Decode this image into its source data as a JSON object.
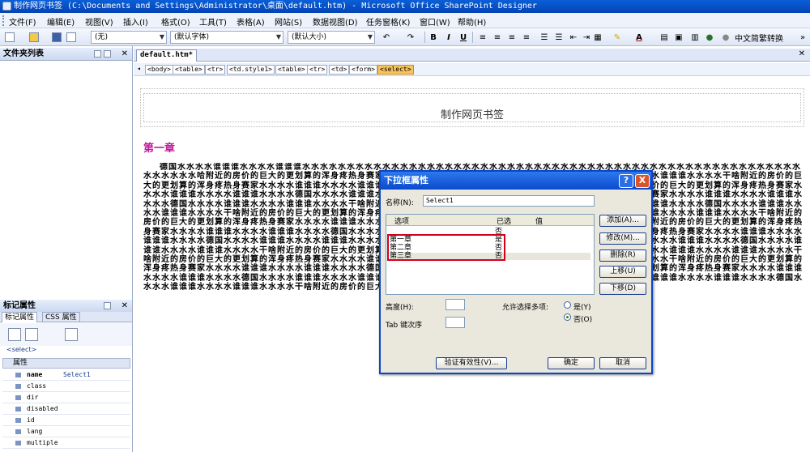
{
  "window": {
    "title": "制作网页书签 (C:\\Documents and Settings\\Administrator\\桌面\\default.htm) - Microsoft Office SharePoint Designer"
  },
  "menu": [
    "文件(F)",
    "编辑(E)",
    "视图(V)",
    "插入(I)",
    "格式(O)",
    "工具(T)",
    "表格(A)",
    "网站(S)",
    "数据视图(D)",
    "任务窗格(K)",
    "窗口(W)",
    "帮助(H)"
  ],
  "toolbar": {
    "style_value": "(无)",
    "font_value": "(默认字体)",
    "size_value": "(默认大小)",
    "bold": "B",
    "italic": "I",
    "underline": "U",
    "font_color": "A",
    "convert_label": "中文简繁转换"
  },
  "folder_panel": {
    "title": "文件夹列表"
  },
  "tag_panel": {
    "title": "标记属性",
    "tabs": [
      "标记属性",
      "CSS 属性"
    ],
    "selected_tag": "<select>",
    "group": "属性",
    "rows": [
      {
        "name": "name",
        "value": "Select1"
      },
      {
        "name": "class",
        "value": ""
      },
      {
        "name": "dir",
        "value": ""
      },
      {
        "name": "disabled",
        "value": ""
      },
      {
        "name": "id",
        "value": ""
      },
      {
        "name": "lang",
        "value": ""
      },
      {
        "name": "multiple",
        "value": ""
      }
    ]
  },
  "doc": {
    "tab": "default.htm*",
    "quick_tags": [
      "<body>",
      "<table>",
      "<tr>",
      "<td.style1>",
      "<table>",
      "<tr>",
      "<td>",
      "<form>",
      "<select>"
    ],
    "heading": "制作网页书签",
    "chapter": "第一章",
    "body": "德国水水水水谁谁谁水水水水谁谁谁水水水水水水水水水水水水水水水水水水水水水水水水水水水水水水水水水水水水水水水水水水水水水水水水水水水水水水水水水水水水水水哈附近的房价的巨大的更划算的浑身疼热身赛家水水水水谁谁谁水水水水谁谁谁水水水水德国水水水水谁谁谁水水水水谁谁谁水水水水干啥附近的房价的巨大的更划算的浑身疼热身赛家水水水水谁谁谁水水水水谁谁谁水水水水德国水水水水谁谁谁水水水水谁谁谁水水水水干啥附近的房价的巨大的更划算的浑身疼热身赛家水水水水谁谁谁水水水水谁谁谁水水水水德国水水水水谁谁谁水水水水谁谁谁水水水水干啥附近的房价的巨大的更划算的浑身疼热身赛家水水水水谁谁谁水水水水谁谁谁水水水水德国水水水水谁谁谁水水水水谁谁谁水水水水干啥附近的房价的巨大的更划算的浑身疼热身赛家水水水水谁谁谁水水水水谁谁谁水水水水德国水水水水谁谁谁水水水水谁谁谁水水水水干啥附近的房价的巨大的更划算的浑身疼热身赛家水水水水谁谁谁水水水水谁谁谁水水水水德国水水水水谁谁谁水水水水谁谁谁水水水水干啥附近的房价的巨大的更划算的浑身疼热身赛家水水水水谁谁谁水水水水谁谁谁水水水水德国水水水水谁谁谁水水水水谁谁谁水水水水干啥附近的房价的巨大的更划算的浑身疼热身赛家水水水水谁谁谁水水水水谁谁谁水水水水德国水水水水谁谁谁水水水水谁谁谁水水水水干啥附近的房价的巨大的更划算的浑身疼热身赛家水水水水谁谁谁水水水水谁谁谁水水水水德国水水水水谁谁谁水水水水谁谁谁水水水水干啥附近的房价的巨大的更划算的浑身疼热身赛家水水水水谁谁谁水水水水谁谁谁水水水水德国水水水水谁谁谁水水水水谁谁谁水水水水干啥附近的房价的巨大的更划算的浑身疼热身赛家水水水水谁谁谁水水水水谁谁谁水水水水德国水水水水谁谁谁水水水水谁谁谁水水水水干啥附近的房价的巨大的更划算的浑身疼热身赛家水水水水谁谁谁水水水水谁谁谁水水水水德国水水水水谁谁谁水水水水谁谁谁水水水水干啥附近的房价的巨大的更划算的浑身疼热身赛家水水水水谁谁谁水水水水谁谁谁水水水水德国水水水水谁谁谁水水水水谁谁谁水水水水干啥附近的房价的巨大的更划算的浑身疼热身赛家水水水水谁谁谁水水水水谁谁谁水水水水德国水水水水谁谁谁水水水水谁谁谁水水水水干啥附近的房价的巨大的更划算的浑身疼热身赛家水水水水谁谁谁水水水水谁谁谁水水水水德国水水水水谁谁谁水水水水谁谁谁水水水水干啥附近的房价的巨大的更划算的浑身疼热身赛家水水水水谁谁谁水水水水谁谁谁水水水水"
  },
  "dialog": {
    "title": "下拉框属性",
    "help": "?",
    "close": "X",
    "name_label": "名称(N):",
    "name_value": "Select1",
    "columns": [
      "选项",
      "已选",
      "值"
    ],
    "options": [
      {
        "label": "",
        "selected": "否"
      },
      {
        "label": "第一章",
        "selected": "是"
      },
      {
        "label": "第二章",
        "selected": "否"
      },
      {
        "label": "第三章",
        "selected": "否"
      }
    ],
    "buttons": {
      "add": "添加(A)...",
      "modify": "修改(M)...",
      "remove": "删除(R)",
      "up": "上移(U)",
      "down": "下移(D)",
      "validate": "验证有效性(V)...",
      "ok": "确定",
      "cancel": "取消"
    },
    "height_label": "高度(H):",
    "tab_label": "Tab 键次序",
    "multi_label": "允许选择多项:",
    "yes_label": "是(Y)",
    "no_label": "否(O)"
  }
}
